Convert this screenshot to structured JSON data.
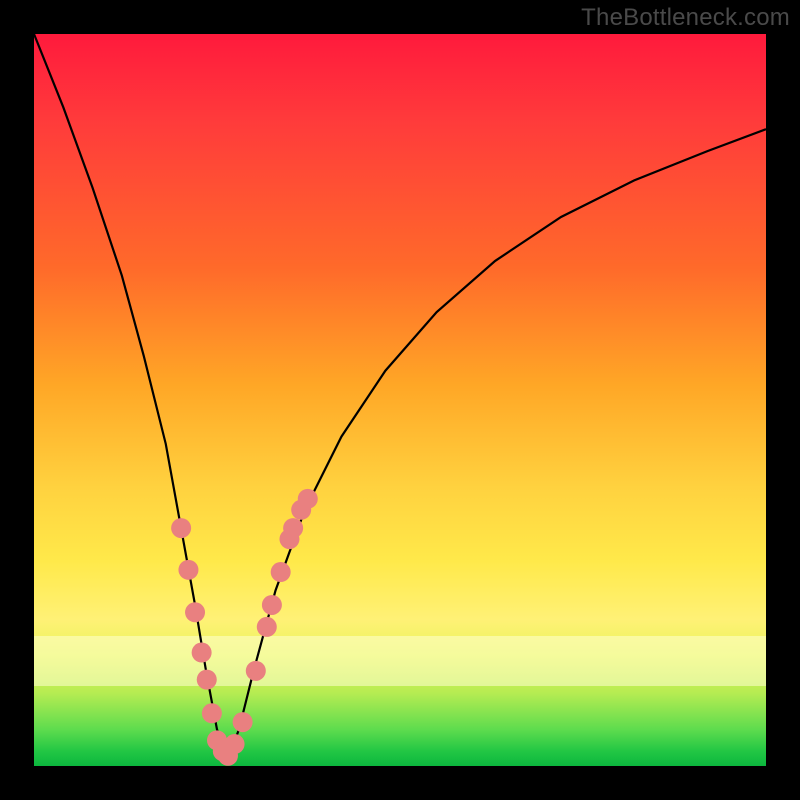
{
  "watermark": "TheBottleneck.com",
  "colors": {
    "curve": "#000000",
    "marker_fill": "#e98080",
    "marker_stroke": "#d86c6c"
  },
  "chart_data": {
    "type": "line",
    "title": "",
    "xlabel": "",
    "ylabel": "",
    "xlim": [
      0,
      100
    ],
    "ylim": [
      0,
      100
    ],
    "series": [
      {
        "name": "bottleneck-curve",
        "x": [
          0,
          4,
          8,
          12,
          15,
          18,
          20,
          22,
          23.5,
          25,
          26.5,
          28,
          30,
          33,
          37,
          42,
          48,
          55,
          63,
          72,
          82,
          92,
          100
        ],
        "y": [
          100,
          90,
          79,
          67,
          56,
          44,
          33,
          22,
          13,
          5,
          1,
          5,
          13,
          24,
          35,
          45,
          54,
          62,
          69,
          75,
          80,
          84,
          87
        ]
      }
    ],
    "markers": {
      "name": "highlight-points",
      "x": [
        20.1,
        21.1,
        22.0,
        22.9,
        23.6,
        24.3,
        25.0,
        25.8,
        26.5,
        27.4,
        28.5,
        30.3,
        31.8,
        32.5,
        33.7,
        34.9,
        35.4,
        36.5,
        37.4
      ],
      "y": [
        32.5,
        26.8,
        21.0,
        15.5,
        11.8,
        7.2,
        3.5,
        2.0,
        1.4,
        3.0,
        6.0,
        13.0,
        19.0,
        22.0,
        26.5,
        31.0,
        32.5,
        35.0,
        36.5
      ]
    }
  }
}
